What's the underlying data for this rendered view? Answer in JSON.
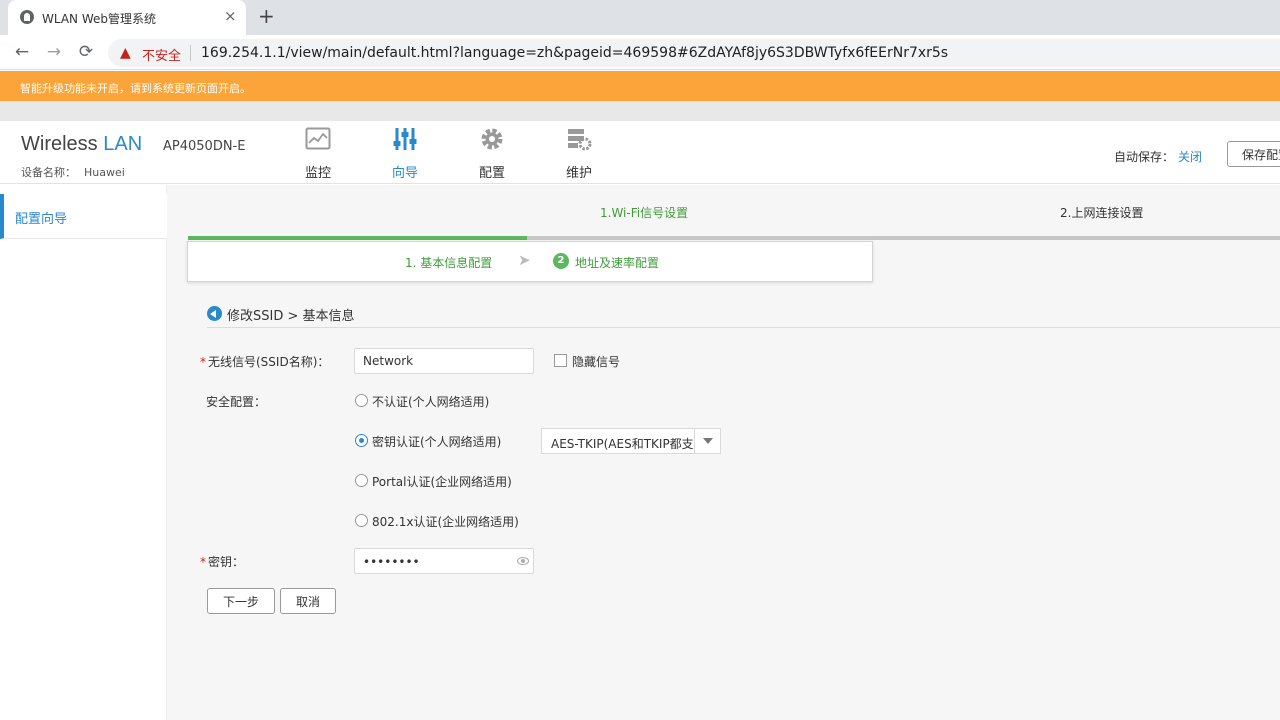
{
  "browser": {
    "tab_title": "WLAN Web管理系统",
    "tab_close": "×",
    "new_tab": "+",
    "back": "←",
    "forward": "→",
    "reload": "⟳",
    "warning_icon": "▲",
    "insecure_label": "不安全",
    "url": "169.254.1.1/view/main/default.html?language=zh&pageid=469598#6ZdAYAf8jy6S3DBWTyfx6fEErNr7xr5s"
  },
  "banner": {
    "text": "智能升级功能未开启，请到系统更新页面开启。"
  },
  "header": {
    "brand_main": "Wireless",
    "brand_accent": "LAN",
    "model": "AP4050DN-E",
    "device_name_label": "设备名称：",
    "device_name": "Huawei",
    "menu": [
      {
        "label": "监控",
        "icon": "monitor-icon"
      },
      {
        "label": "向导",
        "icon": "wizard-sliders-icon"
      },
      {
        "label": "配置",
        "icon": "gear-icon"
      },
      {
        "label": "维护",
        "icon": "maintenance-icon"
      }
    ],
    "autosave_label": "自动保存：",
    "autosave_value": "关闭",
    "save_button": "保存配置"
  },
  "sidebar": {
    "items": [
      {
        "label": "配置向导"
      }
    ]
  },
  "wizard": {
    "steps": [
      {
        "label": "1.Wi-Fi信号设置"
      },
      {
        "label": "2.上网连接设置"
      }
    ],
    "progress_fraction": 0.31,
    "substeps": [
      {
        "label": "1. 基本信息配置"
      },
      {
        "number": "2",
        "label": "地址及速率配置"
      }
    ],
    "substep_arrow": "➤"
  },
  "form": {
    "section_title": "修改SSID > 基本信息",
    "required_mark": "*",
    "ssid_label": "无线信号(SSID名称)：",
    "ssid_value": "Network",
    "hide_ssid_label": "隐藏信号",
    "security_label": "安全配置：",
    "security_options": [
      {
        "label": "不认证(个人网络适用)",
        "checked": false
      },
      {
        "label": "密钥认证(个人网络适用)",
        "checked": true
      },
      {
        "label": "Portal认证(企业网络适用)",
        "checked": false
      },
      {
        "label": "802.1x认证(企业网络适用)",
        "checked": false
      }
    ],
    "encryption_value": "AES-TKIP(AES和TKIP都支持)",
    "key_label": "密钥：",
    "key_value": "••••••••",
    "next_button": "下一步",
    "cancel_button": "取消"
  },
  "colors": {
    "accent": "#2a88cc",
    "banner": "#fba43a",
    "success": "#5cb85c"
  }
}
